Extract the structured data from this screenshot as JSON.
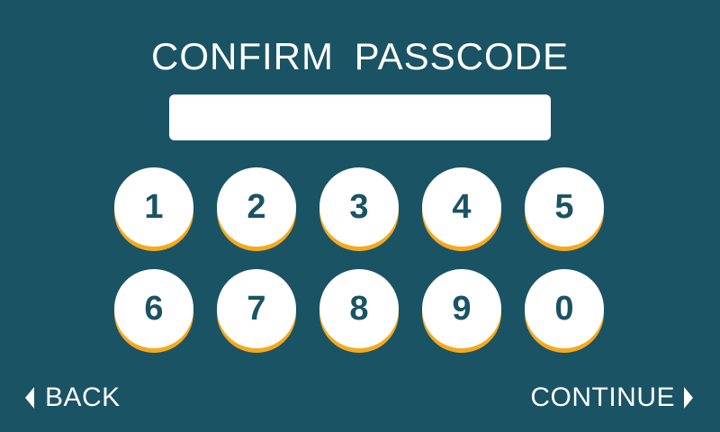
{
  "screen": {
    "title": "CONFIRM  PASSCODE"
  },
  "passcode": {
    "value": ""
  },
  "keypad": {
    "keys": [
      "1",
      "2",
      "3",
      "4",
      "5",
      "6",
      "7",
      "8",
      "9",
      "0"
    ]
  },
  "navigation": {
    "back_label": "BACK",
    "back_icon": "chevron-left-icon",
    "continue_label": "CONTINUE",
    "continue_icon": "chevron-right-icon"
  },
  "colors": {
    "background": "#1a5364",
    "key_face": "#ffffff",
    "key_shadow": "#f6a91e",
    "key_text": "#1a5364",
    "text": "#ffffff"
  }
}
